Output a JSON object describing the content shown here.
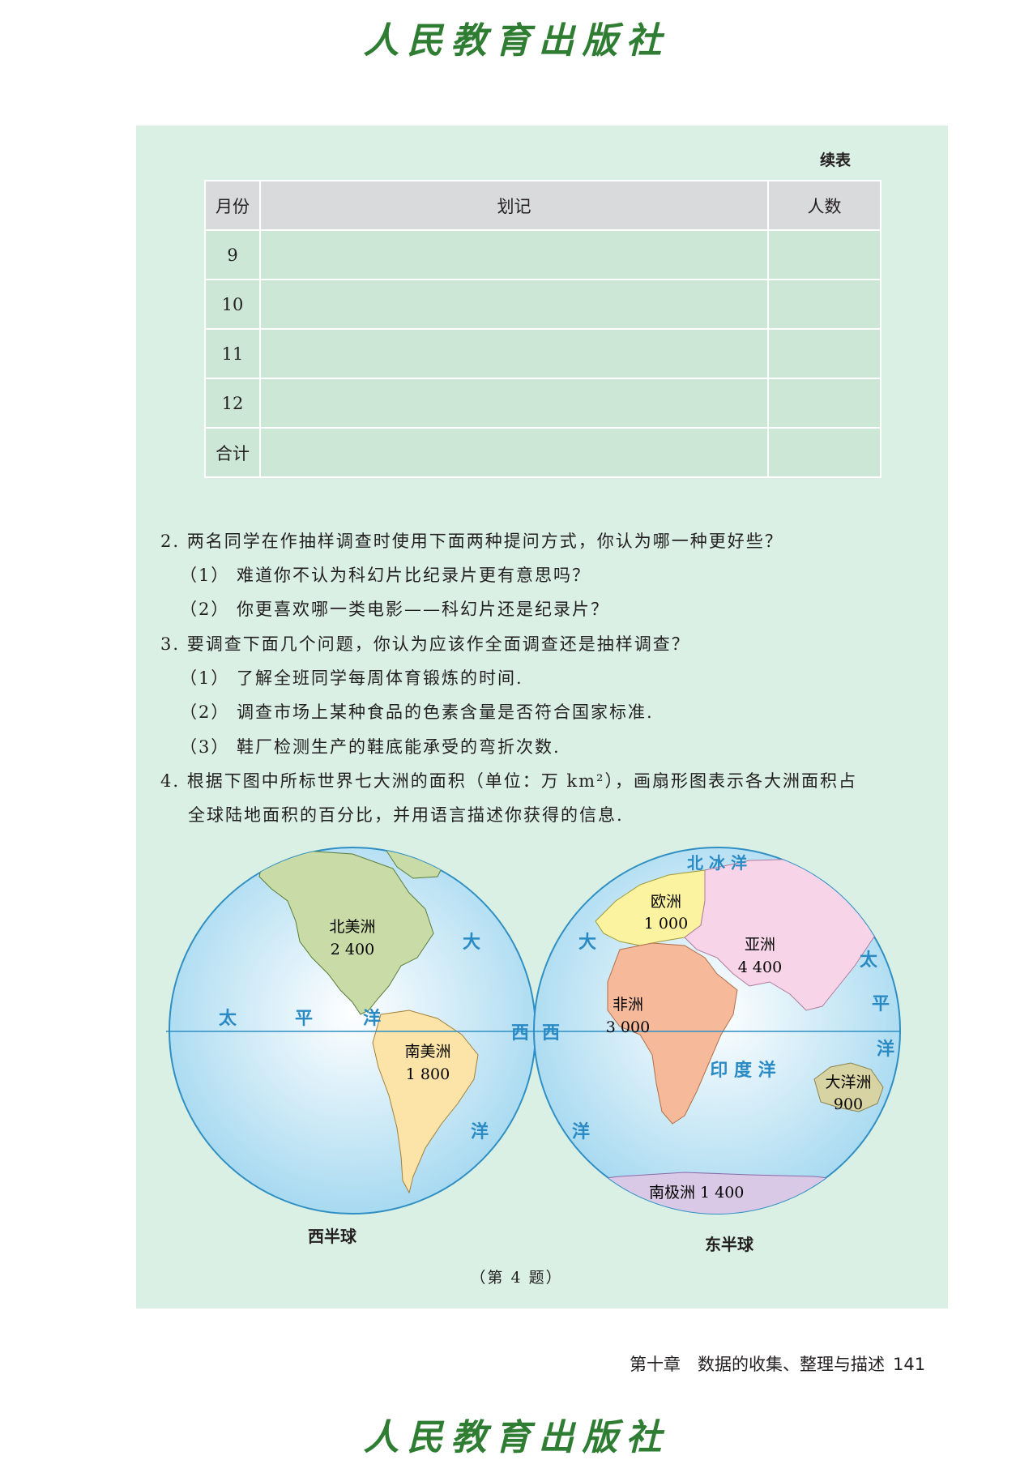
{
  "publisher": "人民教育出版社",
  "table": {
    "continued_label": "续表",
    "headers": [
      "月份",
      "划记",
      "人数"
    ],
    "rows": [
      "9",
      "10",
      "11",
      "12",
      "合计"
    ]
  },
  "q2": {
    "stem": "2. 两名同学在作抽样调查时使用下面两种提问方式，你认为哪一种更好些？",
    "item1": "（1） 难道你不认为科幻片比纪录片更有意思吗？",
    "item2": "（2） 你更喜欢哪一类电影——科幻片还是纪录片？"
  },
  "q3": {
    "stem": "3. 要调查下面几个问题，你认为应该作全面调查还是抽样调查？",
    "item1": "（1） 了解全班同学每周体育锻炼的时间.",
    "item2": "（2） 调查市场上某种食品的色素含量是否符合国家标准.",
    "item3": "（3） 鞋厂检测生产的鞋底能承受的弯折次数."
  },
  "q4": {
    "stem_a": "4. 根据下图中所标世界七大洲的面积（单位：万 km²），画扇形图表示各大洲面积占",
    "stem_b": "全球陆地面积的百分比，并用语言描述你获得的信息."
  },
  "map": {
    "west_label": "西半球",
    "east_label": "东半球",
    "caption": "（第 4 题）",
    "continents": {
      "north_america": {
        "name": "北美洲",
        "area": "2 400"
      },
      "south_america": {
        "name": "南美洲",
        "area": "1 800"
      },
      "europe": {
        "name": "欧洲",
        "area": "1 000"
      },
      "asia": {
        "name": "亚洲",
        "area": "4 400"
      },
      "africa": {
        "name": "非洲",
        "area": "3 000"
      },
      "oceania": {
        "name": "大洋洲",
        "area": "900"
      },
      "antarctica": {
        "name": "南极洲",
        "area": "1 400"
      }
    },
    "oceans": {
      "pacific_w1": "太",
      "pacific_w2": "平",
      "pacific_w3": "洋",
      "atlantic_w1": "大",
      "atlantic_w2": "西",
      "atlantic_w3": "洋",
      "atlantic_e1": "大",
      "atlantic_e2": "西",
      "atlantic_e3": "洋",
      "indian": "印 度 洋",
      "arctic": "北 冰 洋",
      "pacific_e1": "太",
      "pacific_e2": "平",
      "pacific_e3": "洋"
    },
    "colors": {
      "ocean": "#bfe6f5",
      "north_america": "#c9dba6",
      "south_america": "#fce3a8",
      "europe": "#fbf3a0",
      "asia": "#f8d4e8",
      "africa": "#f6b99a",
      "oceania": "#d8d3a2",
      "antarctica": "#d9c9e6"
    }
  },
  "footer": {
    "chapter": "第十章　数据的收集、整理与描述",
    "page": "141"
  }
}
